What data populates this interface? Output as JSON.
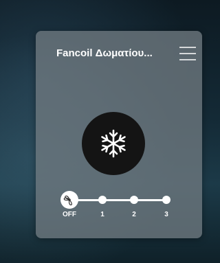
{
  "card": {
    "title": "Fancoil Δωματίου...",
    "menu_icon": "hamburger-menu-icon"
  },
  "mode": {
    "icon": "snowflake-icon",
    "state": "cooling"
  },
  "fan_speed": {
    "selected": "OFF",
    "levels": [
      {
        "label": "OFF",
        "icon": "fan-icon"
      },
      {
        "label": "1"
      },
      {
        "label": "2"
      },
      {
        "label": "3"
      }
    ]
  },
  "colors": {
    "card_bg": "#707a80",
    "mode_button_bg": "#141414",
    "accent": "#ffffff"
  }
}
